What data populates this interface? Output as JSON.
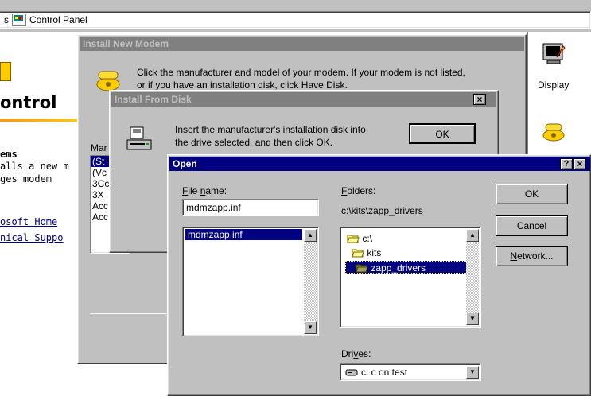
{
  "addressbar": {
    "left_fragment": "s",
    "label": "Control Panel"
  },
  "cp_page": {
    "heading": "ontrol",
    "section_title": "ems",
    "desc_line1": "alls a new m",
    "desc_line2": "ges modem",
    "link1": "osoft Home",
    "link2": "nical Suppo"
  },
  "cp_icons": {
    "display_label": "Display"
  },
  "install_modem": {
    "title": "Install New Modem",
    "text_line1": "Click the manufacturer and model of your modem. If your modem is not listed,",
    "text_line2": "or if you have an installation disk, click Have Disk.",
    "mfr_label": "Mar",
    "mfr_items": [
      "(St",
      "(Vc",
      "3Cc",
      "3X",
      "Acc",
      "Acc"
    ]
  },
  "install_disk": {
    "title": "Install From Disk",
    "text_line1": "Insert the manufacturer's installation disk into",
    "text_line2": "the drive selected, and then click OK.",
    "ok_label": "OK",
    "close_label": "×"
  },
  "open_dialog": {
    "title": "Open",
    "help_label": "?",
    "close_label": "×",
    "file_name_label": "File name:",
    "file_name_value": "mdmzapp.inf",
    "files": [
      "mdmzapp.inf"
    ],
    "folders_label": "Folders:",
    "current_path": "c:\\kits\\zapp_drivers",
    "folders": [
      "c:\\",
      "kits",
      "zapp_drivers"
    ],
    "drives_label": "Drives:",
    "drive_value": "c: c on test",
    "ok_label": "OK",
    "cancel_label": "Cancel",
    "network_label": "Network..."
  }
}
